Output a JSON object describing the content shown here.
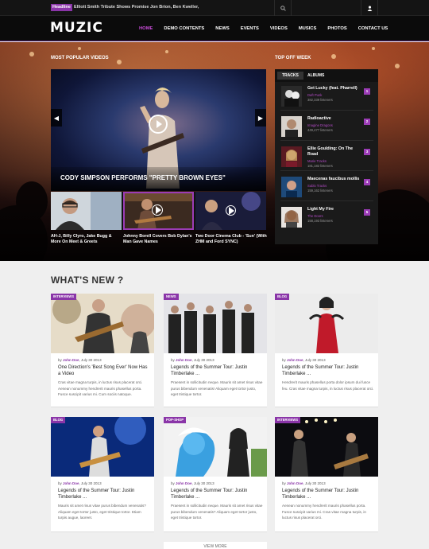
{
  "topbar": {
    "headline_badge": "Headline",
    "headline_text": "Elliott Smith Tribute Shows Promise Jon Brion, Ben Kweller,"
  },
  "header": {
    "logo": "MUZIC",
    "nav": [
      "HOME",
      "DEMO CONTENTS",
      "NEWS",
      "EVENTS",
      "VIDEOS",
      "MUSICS",
      "PHOTOS",
      "CONTACT US"
    ],
    "active_nav": "HOME"
  },
  "popular": {
    "label": "MOST POPULAR VIDEOS",
    "main_caption": "CODY SIMPSON PERFORMS \"PRETTY BROWN EYES\"",
    "thumbs": [
      {
        "title": "AH-J, Billy Clyro, Jake Bugg & More On Meet & Greets"
      },
      {
        "title": "Johnny Borell Covers Bob Dylan's Man Gave Names"
      },
      {
        "title": "Two Door Cinema Club - 'Sun' (With ZHM and Ford SYNC)"
      }
    ]
  },
  "topweek": {
    "label": "TOP OFF WEEK",
    "tabs": [
      "TRACKS",
      "ALBUMS"
    ],
    "tracks": [
      {
        "title": "Get Lucky (feat. Pharrell)",
        "artist": "Daft Punk",
        "listens": "382,339 listeners",
        "rank": "1"
      },
      {
        "title": "Radioactive",
        "artist": "Imagine Dragons",
        "listens": "449,477 listeners",
        "rank": "2"
      },
      {
        "title": "Ellie Goulding: On The Road",
        "artist": "Marie Tracks",
        "listens": "181,182 listeners",
        "rank": "3"
      },
      {
        "title": "Maecenas faucibus mollis",
        "artist": "Sublo Tracks",
        "listens": "159,162 listeners",
        "rank": "4"
      },
      {
        "title": "Light My Fire",
        "artist": "The Doors",
        "listens": "158,193 listeners",
        "rank": "5"
      }
    ]
  },
  "whatsnew": {
    "title": "WHAT'S NEW ?",
    "by": "by",
    "cards": [
      {
        "badge": "INTERVIEWS",
        "author": "John Doe",
        "date": ", July 30 2013",
        "title": "One Direction's 'Best Song Ever' Now Has a Video",
        "body": "Cras vitae magna turpis, in luctus risus placerat orci. Aenean nonummy hendrerit mauris phasellus porta. Fusce suscipit varius mi. Cum sociis natoque."
      },
      {
        "badge": "NEWS",
        "author": "John Doe",
        "date": ", July 30 2013",
        "title": "Legends of the Summer Tour: Justin Timberlake ...",
        "body": "Praesent in sollicitudin neque. Mauris sit amet risus vitae purus bibendum venenatis! Aliquam eget tortor justo, eget tristique tortor."
      },
      {
        "badge": "BLOG",
        "author": "John Doe",
        "date": ", July 30 2013",
        "title": "Legends of the Summer Tour: Justin Timberlake ...",
        "body": "Hendrerit mauris phasellus porta dolor ipsum dui fusce feu. Cras vitae magna turpis, in luctus risus placerat orci."
      },
      {
        "badge": "BLOG",
        "author": "John Doe",
        "date": ", July 30 2013",
        "title": "Legends of the Summer Tour: Justin Timberlake ...",
        "body": "Mauris sit amet risus vitae purus bibendum venenatis? Aliquam eget tortor justo, eget tristique tortor. Etiam turpis augue, laoreet."
      },
      {
        "badge": "POP-SHOP",
        "author": "John Doe",
        "date": ", July 30 2013",
        "title": "Legends of the Summer Tour: Justin Timberlake ...",
        "body": "Praesent in sollicitudin neque. Mauris sit amet risus vitae purus bibendum venenatis? Aliquam eget tortor justo, eget tristique tortor."
      },
      {
        "badge": "INTERVIEWS",
        "author": "John Doe",
        "date": ", July 30 2013",
        "title": "Legends of the Summer Tour: Justin Timberlake ...",
        "body": "Aenean nonummy hendrerit mauris phasellus porta. Fusce suscipit varius mi. Cras vitae magna turpis, in luctus risus placerat orci."
      }
    ],
    "more_label": "VIEW MORE"
  },
  "colors": {
    "accent": "#8a35a8",
    "header_bg": "#0b0b0b",
    "page_bg": "#efefef"
  },
  "icons": [
    "search-icon",
    "user-icon",
    "play-icon",
    "chevron-left-icon",
    "chevron-right-icon"
  ]
}
